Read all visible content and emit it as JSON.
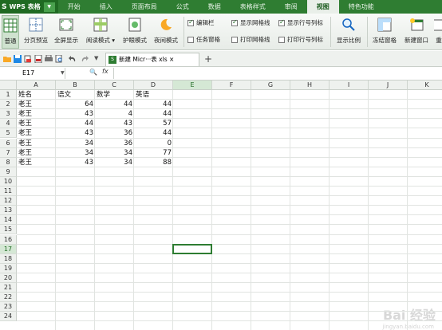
{
  "app": {
    "logo_s": "S",
    "logo_text": "WPS 表格"
  },
  "menu": [
    "开始",
    "插入",
    "页面布局",
    "公式",
    "数据",
    "表格样式",
    "审阅",
    "视图",
    "特色功能"
  ],
  "ribbon": {
    "buttons": [
      {
        "label": "普通",
        "icon": "normal-view-icon"
      },
      {
        "label": "分页预览",
        "icon": "page-break-preview-icon"
      },
      {
        "label": "全屏显示",
        "icon": "fullscreen-icon"
      },
      {
        "label": "阅读模式 ▾",
        "icon": "reading-mode-icon"
      },
      {
        "label": "护眼模式",
        "icon": "eye-care-icon"
      },
      {
        "label": "夜间模式",
        "icon": "night-mode-icon"
      },
      {
        "label": "显示比例",
        "icon": "zoom-icon"
      },
      {
        "label": "冻结窗格",
        "icon": "freeze-panes-icon"
      },
      {
        "label": "新建窗口",
        "icon": "new-window-icon"
      },
      {
        "label": "重",
        "icon": "rearrange-icon"
      }
    ],
    "checks": [
      {
        "label": "编辑栏",
        "checked": true
      },
      {
        "label": "任务窗格",
        "checked": false
      },
      {
        "label": "显示网格线",
        "checked": true
      },
      {
        "label": "显示行号列标",
        "checked": true
      },
      {
        "label": "打印网格线",
        "checked": false
      },
      {
        "label": "打印行号列标",
        "checked": false
      }
    ]
  },
  "doc_tab": {
    "label": "新建 Micr···表 xls ×",
    "icon_text": "S"
  },
  "formula_bar": {
    "name_box": "E17",
    "fx": "fx",
    "zoom": "🔍"
  },
  "columns": [
    "A",
    "B",
    "C",
    "D",
    "E",
    "F",
    "G",
    "H",
    "I",
    "J",
    "K"
  ],
  "rows": [
    "1",
    "2",
    "3",
    "4",
    "5",
    "6",
    "7",
    "8",
    "9",
    "10",
    "11",
    "12",
    "13",
    "14",
    "15",
    "16",
    "17",
    "18",
    "19",
    "20",
    "21",
    "22",
    "23",
    "24"
  ],
  "table": {
    "headers": [
      "姓名",
      "语文",
      "数学",
      "英语"
    ],
    "rows": [
      [
        "老王",
        "64",
        "44",
        "44"
      ],
      [
        "老王",
        "43",
        "4",
        "44"
      ],
      [
        "老王",
        "44",
        "43",
        "57"
      ],
      [
        "老王",
        "43",
        "36",
        "44"
      ],
      [
        "老王",
        "34",
        "36",
        "0"
      ],
      [
        "老王",
        "34",
        "34",
        "77"
      ],
      [
        "老王",
        "43",
        "34",
        "88"
      ]
    ]
  },
  "active_cell": "E17",
  "watermark": {
    "main": "Bai 经验",
    "sub": "jingyan.baidu.com"
  },
  "colors": {
    "accent": "#2e7d32",
    "menubar": "#2f7d32"
  }
}
